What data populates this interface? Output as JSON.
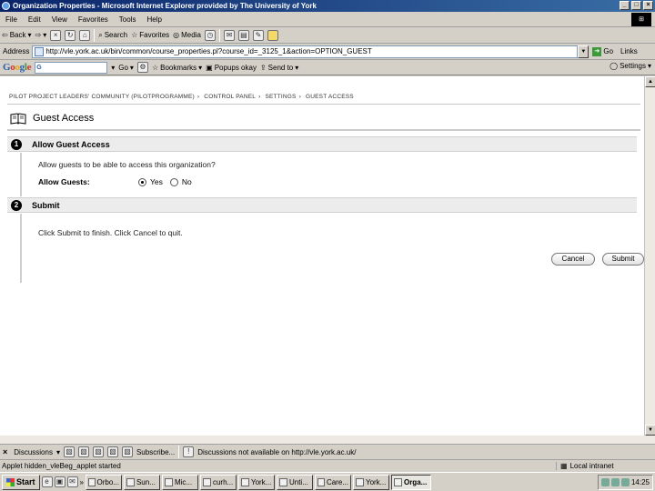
{
  "window": {
    "title": "Organization Properties - Microsoft Internet Explorer provided by The University of York"
  },
  "menu": [
    "File",
    "Edit",
    "View",
    "Favorites",
    "Tools",
    "Help"
  ],
  "toolbar": {
    "back": "Back",
    "search": "Search",
    "favorites": "Favorites",
    "media": "Media"
  },
  "address": {
    "label": "Address",
    "url": "http://vle.york.ac.uk/bin/common/course_properties.pl?course_id=_3125_1&action=OPTION_GUEST",
    "go": "Go",
    "links": "Links"
  },
  "google": {
    "logo": "Google",
    "go": "Go",
    "bookmarks": "Bookmarks",
    "popups": "Popups okay",
    "send_to": "Send to",
    "settings": "Settings"
  },
  "page": {
    "breadcrumb": [
      "PILOT PROJECT LEADERS' COMMUNITY (PILOTPROGRAMME)",
      "CONTROL PANEL",
      "SETTINGS",
      "GUEST ACCESS"
    ],
    "title": "Guest Access",
    "step1": {
      "number": "1",
      "title": "Allow Guest Access",
      "instructions": "Allow guests to be able to access this organization?",
      "field_label": "Allow Guests:",
      "options": [
        "Yes",
        "No"
      ],
      "selected": "Yes"
    },
    "step2": {
      "number": "2",
      "title": "Submit",
      "instructions": "Click Submit to finish. Click Cancel to quit."
    },
    "cancel": "Cancel",
    "submit": "Submit"
  },
  "discussions": {
    "label": "Discussions",
    "subscribe": "Subscribe...",
    "message": "Discussions not available on http://vle.york.ac.uk/"
  },
  "status": {
    "message": "Applet hidden_vleBeg_applet started",
    "zone": "Local intranet"
  },
  "taskbar": {
    "start": "Start",
    "tasks": [
      "Orbo...",
      "Sun...",
      "Mic...",
      "curh...",
      "York...",
      "Unti...",
      "Care...",
      "York...",
      "Orga..."
    ],
    "clock": "14:25"
  }
}
